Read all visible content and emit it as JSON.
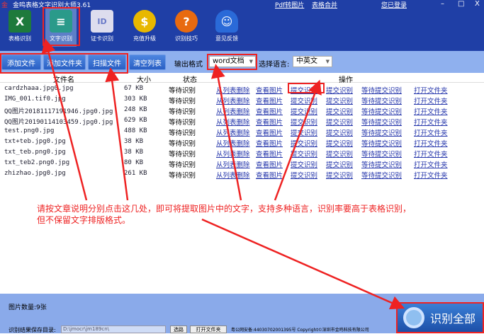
{
  "app": {
    "title": "金鸣表格文字识别大师3.61",
    "links": [
      "Pdf转图片",
      "表格合并",
      "您已登录"
    ],
    "window_buttons": [
      "–",
      "□",
      "X"
    ]
  },
  "modes": [
    {
      "label": "表格识别",
      "icon": "excel-icon",
      "color": "#1e7a3c",
      "glyph": "X"
    },
    {
      "label": "文字识别",
      "icon": "document-icon",
      "color": "#2a9a8a",
      "glyph": "≡"
    },
    {
      "label": "证卡识别",
      "icon": "id-card-icon",
      "color": "#6a7ac8",
      "glyph": "ID"
    },
    {
      "label": "充值升级",
      "icon": "coin-icon",
      "color": "#e8b800",
      "glyph": "$"
    },
    {
      "label": "识别技巧",
      "icon": "help-icon",
      "color": "#e86a10",
      "glyph": "?"
    },
    {
      "label": "意见反馈",
      "icon": "qq-icon",
      "color": "#2a6ad8",
      "glyph": "☺"
    }
  ],
  "toolbar": {
    "add_file": "添加文件",
    "add_folder": "添加文件夹",
    "scan_file": "扫描文件",
    "clear_list": "清空列表",
    "output_format_label": "输出格式",
    "output_format": "word文档",
    "language_label": "选择语言:",
    "language": "中英文"
  },
  "table": {
    "headers": [
      "文件名",
      "大小",
      "状态",
      "操作"
    ],
    "actions": [
      "从列表删除",
      "查看图片",
      "提交识别",
      "提交识别",
      "等待提交识别",
      "打开文件夹"
    ],
    "rows": [
      {
        "name": "cardzhaaa.jpg0.jpg",
        "size": "67 KB",
        "status": "等待识别"
      },
      {
        "name": "IMG_001.tif0.jpg",
        "size": "303 KB",
        "status": "等待识别"
      },
      {
        "name": "QQ图片20181117191946.jpg0.jpg",
        "size": "248 KB",
        "status": "等待识别"
      },
      {
        "name": "QQ图片20190114103459.jpg0.jpg",
        "size": "629 KB",
        "status": "等待识别"
      },
      {
        "name": "test.png0.jpg",
        "size": "488 KB",
        "status": "等待识别"
      },
      {
        "name": "txt+teb.jpg0.jpg",
        "size": "38 KB",
        "status": "等待识别"
      },
      {
        "name": "txt_teb.png0.jpg",
        "size": "38 KB",
        "status": "等待识别"
      },
      {
        "name": "txt_teb2.png0.jpg",
        "size": "80 KB",
        "status": "等待识别"
      },
      {
        "name": "zhizhao.jpg0.jpg",
        "size": "261 KB",
        "status": "等待识别"
      }
    ]
  },
  "annotation": {
    "line1": "请按文章说明分别点击这几处，即可将提取图片中的文字，支持多种语言，识别率要高于表格识别，",
    "line2": "但不保留文字排版格式。",
    "color": "#e22222"
  },
  "footer": {
    "count": "图片数量:9张",
    "save_dir_label": "识别结果保存目录:",
    "save_dir": "D:\\jmocr\\jm189cn\\",
    "browse": "选路",
    "open_folder": "打开文件夹",
    "icp": "粤公网安备:44030702001395号 Copyright©深圳市金鸣科技有限公司",
    "recognize_all": "识别全部"
  }
}
